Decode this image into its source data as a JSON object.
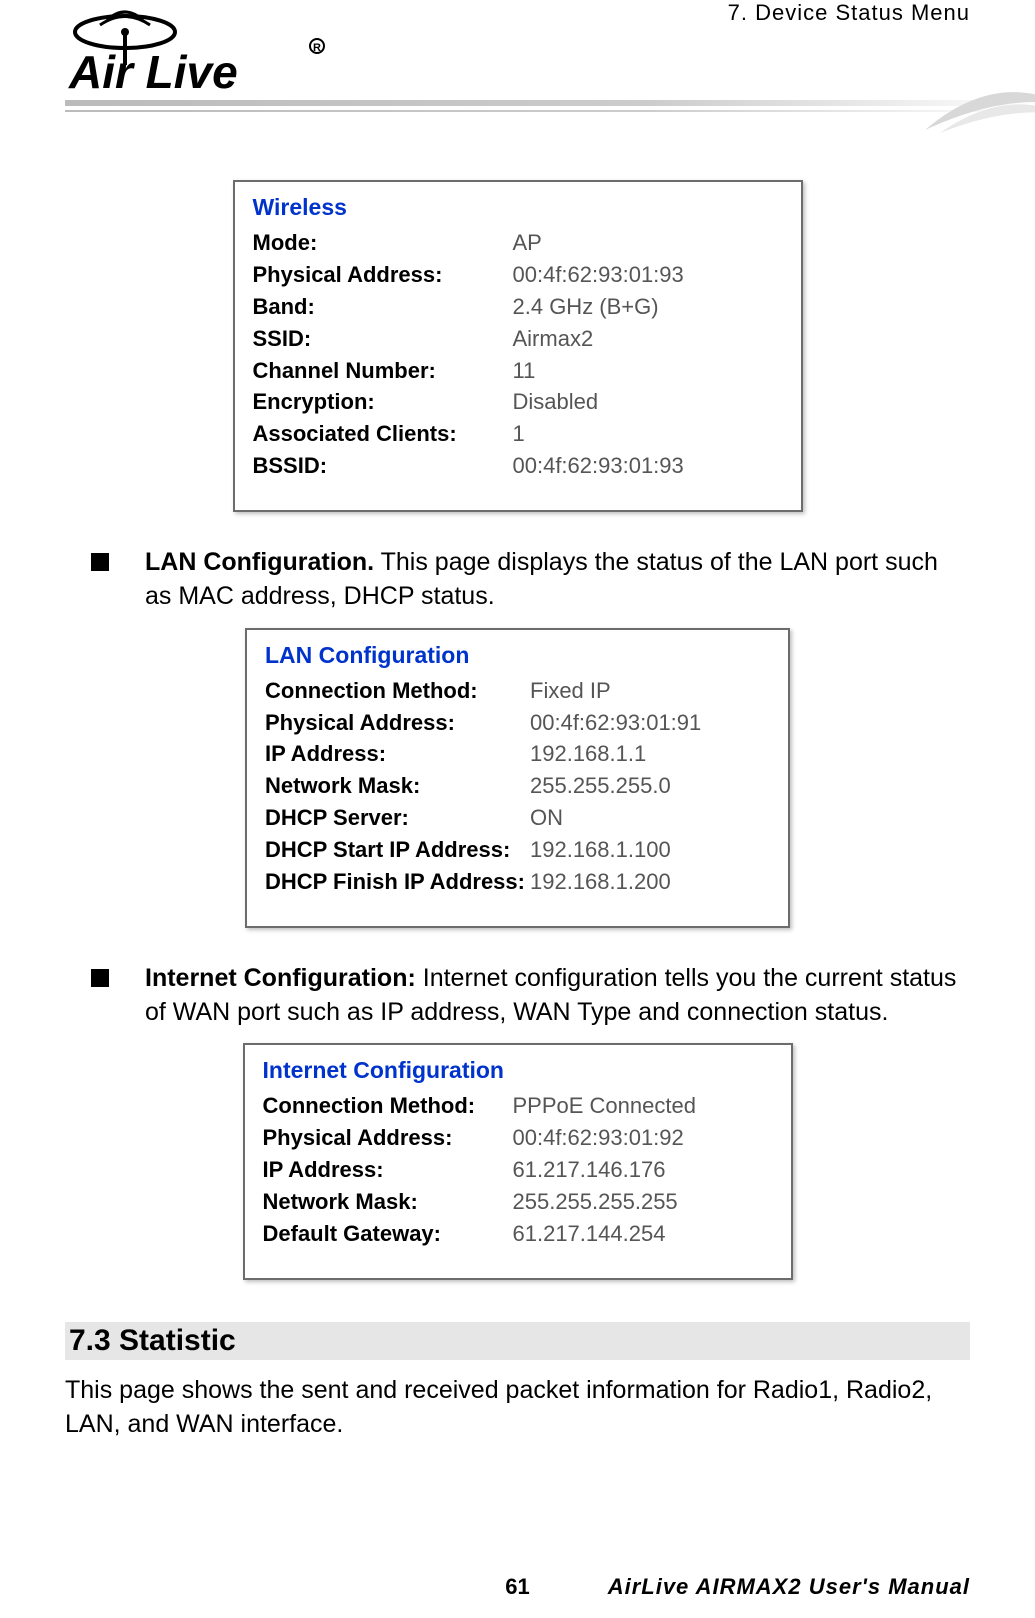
{
  "header": {
    "chapter": "7. Device Status Menu",
    "logo_alt": "Air Live"
  },
  "panels": {
    "wireless": {
      "title": "Wireless",
      "rows": [
        {
          "label": "Mode:",
          "value": "AP"
        },
        {
          "label": "Physical Address:",
          "value": "00:4f:62:93:01:93"
        },
        {
          "label": "Band:",
          "value": "2.4 GHz (B+G)"
        },
        {
          "label": "SSID:",
          "value": "Airmax2"
        },
        {
          "label": "Channel Number:",
          "value": "11"
        },
        {
          "label": "Encryption:",
          "value": "Disabled"
        },
        {
          "label": "Associated Clients:",
          "value": "1"
        },
        {
          "label": "BSSID:",
          "value": "00:4f:62:93:01:93"
        }
      ]
    },
    "lan": {
      "title": "LAN Configuration",
      "rows": [
        {
          "label": "Connection Method:",
          "value": "Fixed IP"
        },
        {
          "label": "Physical Address:",
          "value": "00:4f:62:93:01:91"
        },
        {
          "label": "IP Address:",
          "value": "192.168.1.1"
        },
        {
          "label": "Network Mask:",
          "value": "255.255.255.0"
        },
        {
          "label": "DHCP Server:",
          "value": "ON"
        },
        {
          "label": "DHCP Start IP Address:",
          "value": "192.168.1.100"
        },
        {
          "label": "DHCP Finish IP Address:",
          "value": "192.168.1.200"
        }
      ]
    },
    "internet": {
      "title": "Internet Configuration",
      "rows": [
        {
          "label": "Connection Method:",
          "value": "PPPoE Connected"
        },
        {
          "label": "Physical Address:",
          "value": "00:4f:62:93:01:92"
        },
        {
          "label": "IP Address:",
          "value": "61.217.146.176"
        },
        {
          "label": "Network Mask:",
          "value": "255.255.255.255"
        },
        {
          "label": "Default Gateway:",
          "value": "61.217.144.254"
        }
      ]
    }
  },
  "bullets": {
    "lan": {
      "bold": "LAN Configuration.",
      "rest": "   This page displays the status of the LAN port such as MAC address, DHCP status."
    },
    "internet": {
      "bold": "Internet Configuration:",
      "rest": "   Internet configuration tells you the current status of WAN port such as IP address, WAN Type and connection status."
    }
  },
  "section": {
    "heading": "7.3 Statistic",
    "para": "This page shows the sent and received packet information for Radio1, Radio2, LAN, and WAN interface."
  },
  "footer": {
    "page": "61",
    "title": "AirLive AIRMAX2 User's Manual"
  }
}
